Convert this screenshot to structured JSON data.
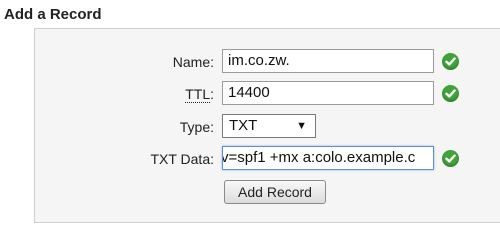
{
  "form": {
    "title": "Add a Record",
    "name_label": "Name:",
    "name_value": "im.co.zw.",
    "ttl_label": "TTL",
    "ttl_colon": ":",
    "ttl_value": "14400",
    "type_label": "Type:",
    "type_value": "TXT",
    "txt_label": "TXT Data:",
    "txt_value": "v=spf1 +mx a:colo.example.c",
    "submit_label": "Add Record"
  },
  "colors": {
    "valid_check": "#3fa33a",
    "focus_border": "#5a8fd6"
  },
  "icons": {
    "valid": "check-circle-icon",
    "dropdown": "triangle-down-icon"
  }
}
